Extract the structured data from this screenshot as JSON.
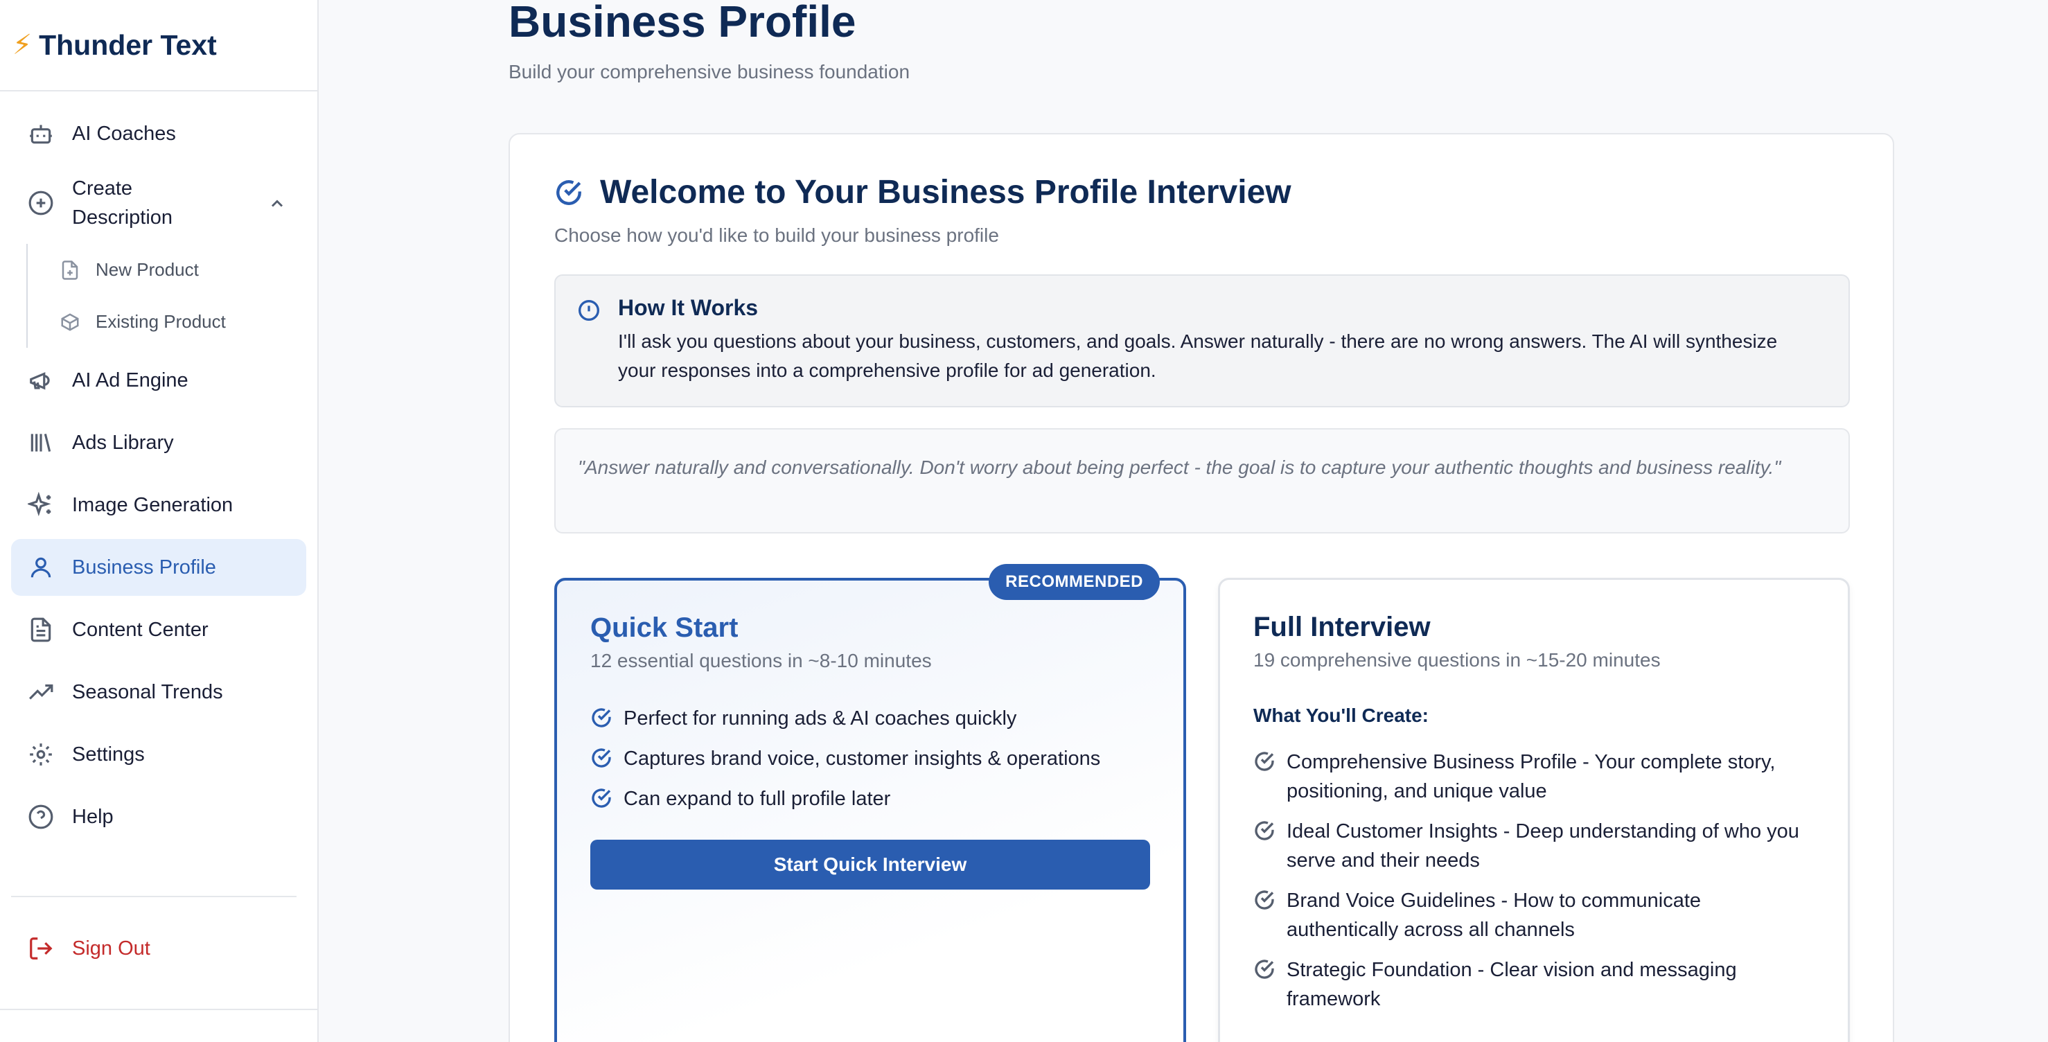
{
  "app": {
    "name": "Thunder Text",
    "logo_icon": "bolt-icon"
  },
  "sidebar": {
    "items": [
      {
        "label": "AI Coaches",
        "icon": "robot-icon"
      },
      {
        "label": "Create Description",
        "icon": "plus-circle-icon",
        "expanded": true,
        "children": [
          {
            "label": "New Product",
            "icon": "file-plus-icon"
          },
          {
            "label": "Existing Product",
            "icon": "box-icon"
          }
        ]
      },
      {
        "label": "AI Ad Engine",
        "icon": "megaphone-icon"
      },
      {
        "label": "Ads Library",
        "icon": "library-icon"
      },
      {
        "label": "Image Generation",
        "icon": "sparkles-icon"
      },
      {
        "label": "Business Profile",
        "icon": "user-icon",
        "active": true
      },
      {
        "label": "Content Center",
        "icon": "document-icon"
      },
      {
        "label": "Seasonal Trends",
        "icon": "trending-up-icon"
      },
      {
        "label": "Settings",
        "icon": "gear-icon"
      },
      {
        "label": "Help",
        "icon": "help-circle-icon"
      }
    ],
    "signout": {
      "label": "Sign Out",
      "icon": "logout-icon"
    }
  },
  "page": {
    "title": "Business Profile",
    "subtitle": "Build your comprehensive business foundation"
  },
  "welcome": {
    "title": "Welcome to Your Business Profile Interview",
    "subtitle": "Choose how you'd like to build your business profile"
  },
  "how_it_works": {
    "title": "How It Works",
    "text": "I'll ask you questions about your business, customers, and goals. Answer naturally - there are no wrong answers. The AI will synthesize your responses into a comprehensive profile for ad generation."
  },
  "quote": "\"Answer naturally and conversationally. Don't worry about being perfect - the goal is to capture your authentic thoughts and business reality.\"",
  "quick_start": {
    "badge": "RECOMMENDED",
    "title": "Quick Start",
    "subtitle": "12 essential questions in ~8-10 minutes",
    "features": [
      "Perfect for running ads & AI coaches quickly",
      "Captures brand voice, customer insights & operations",
      "Can expand to full profile later"
    ],
    "button": "Start Quick Interview"
  },
  "full_interview": {
    "title": "Full Interview",
    "subtitle": "19 comprehensive questions in ~15-20 minutes",
    "create_heading": "What You'll Create:",
    "features": [
      "Comprehensive Business Profile - Your complete story, positioning, and unique value",
      "Ideal Customer Insights - Deep understanding of who you serve and their needs",
      "Brand Voice Guidelines - How to communicate authentically across all channels",
      "Strategic Foundation - Clear vision and messaging framework"
    ]
  },
  "colors": {
    "accent": "#2a5db0",
    "heading": "#0f2a55",
    "danger": "#c42b2b",
    "active_bg": "#e6effc"
  }
}
